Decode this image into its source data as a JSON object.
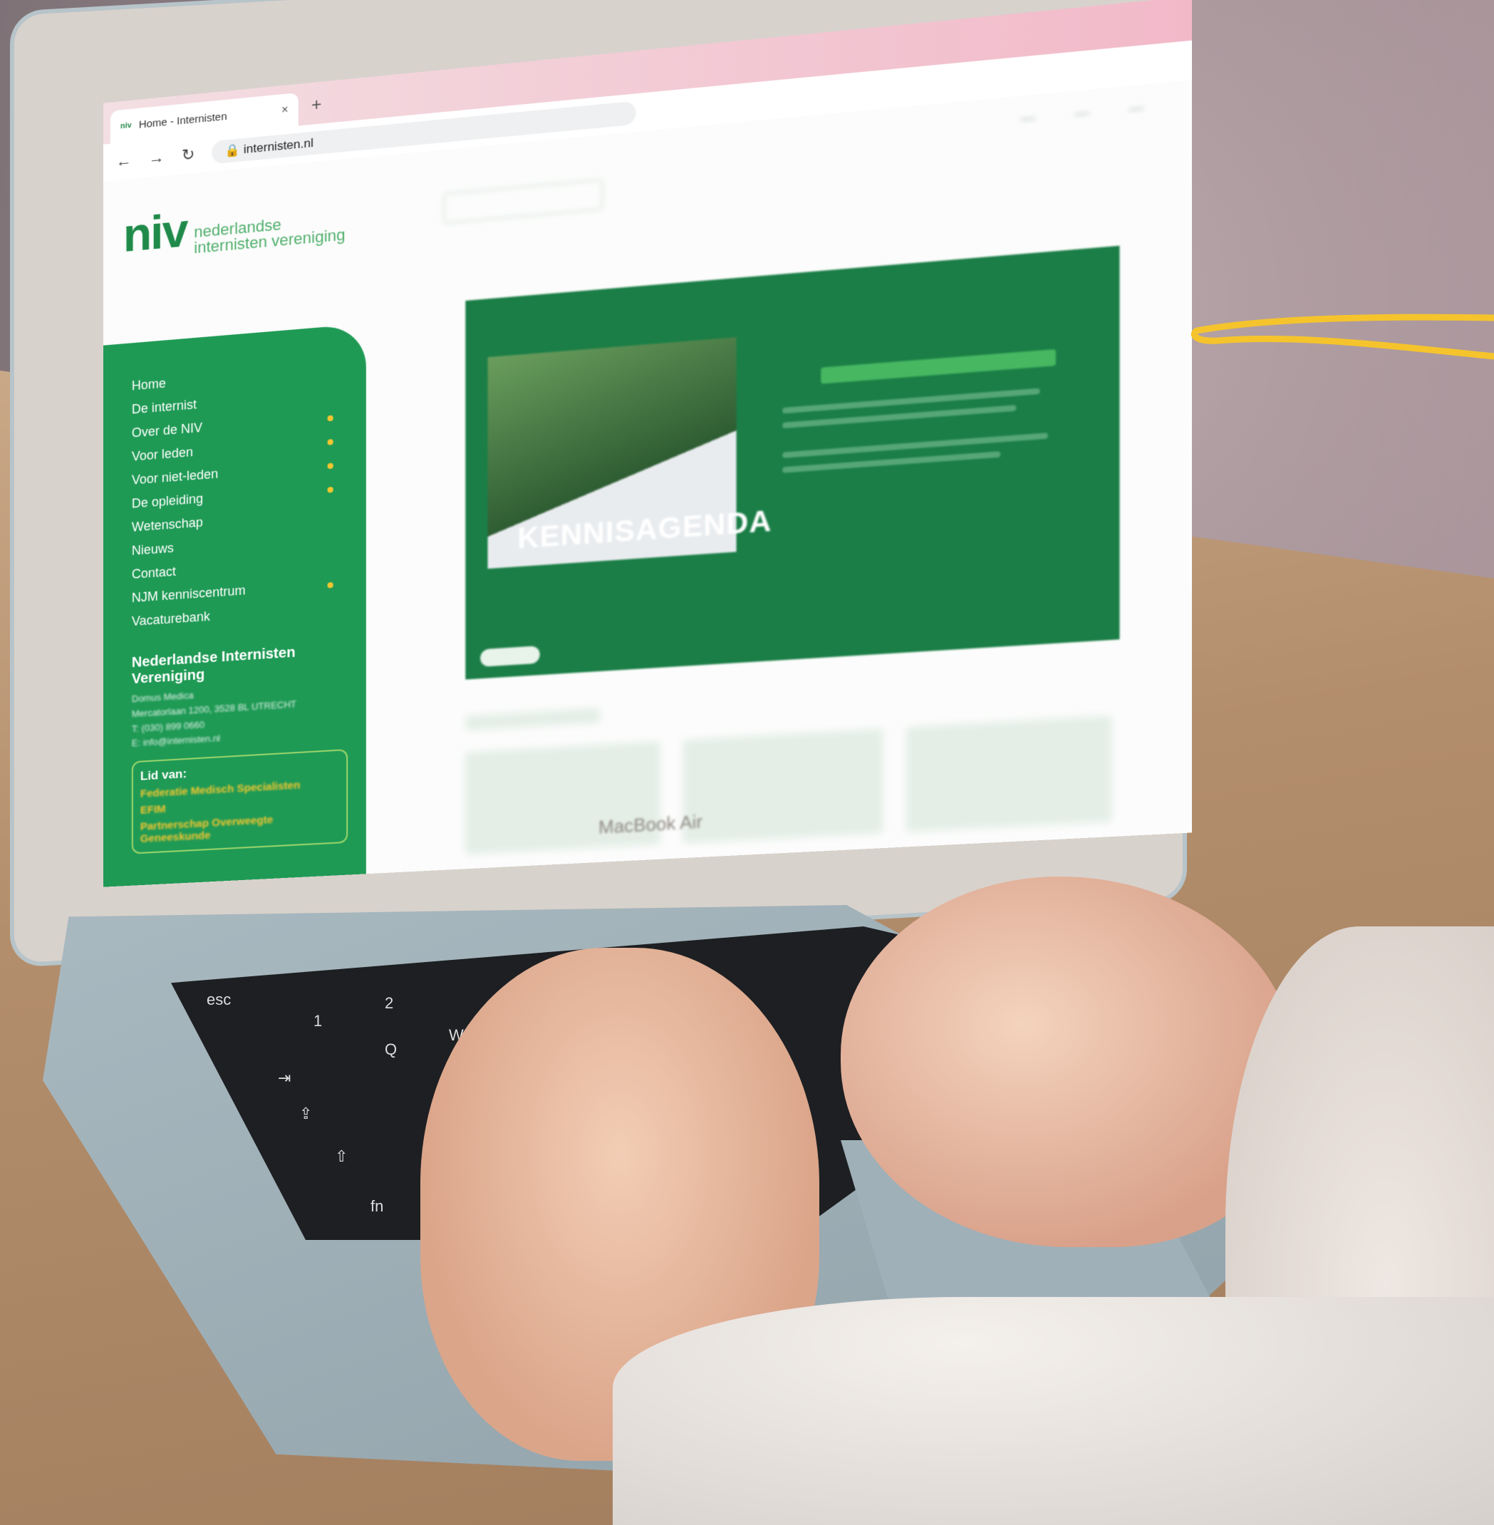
{
  "browser": {
    "tab_title": "Home - Internisten",
    "tab_favicon_text": "niv",
    "close_symbol": "×",
    "new_tab_symbol": "+",
    "url": "internisten.nl"
  },
  "site": {
    "logo_mark": "niv",
    "logo_line1": "nederlandse",
    "logo_line2": "internisten vereniging",
    "nav": [
      {
        "label": "Home",
        "has_submenu": false
      },
      {
        "label": "De internist",
        "has_submenu": false
      },
      {
        "label": "Over de NIV",
        "has_submenu": true
      },
      {
        "label": "Voor leden",
        "has_submenu": true
      },
      {
        "label": "Voor niet-leden",
        "has_submenu": true
      },
      {
        "label": "De opleiding",
        "has_submenu": true
      },
      {
        "label": "Wetenschap",
        "has_submenu": false
      },
      {
        "label": "Nieuws",
        "has_submenu": false
      },
      {
        "label": "Contact",
        "has_submenu": false
      },
      {
        "label": "NJM kenniscentrum",
        "has_submenu": true
      },
      {
        "label": "Vacaturebank",
        "has_submenu": false
      }
    ],
    "org_name": "Nederlandse Internisten Vereniging",
    "address_line1": "Domus Medica",
    "address_line2": "Mercatorlaan 1200, 3528 BL UTRECHT",
    "phone": "T: (030) 899 0660",
    "email": "E: info@internisten.nl",
    "member_of_title": "Lid van:",
    "member_of": [
      "Federatie Medisch Specialisten",
      "EFIM",
      "Partnerschap Overweegte Geneeskunde"
    ],
    "hero_word": "KENNISAGENDA"
  },
  "laptop_label": "MacBook Air",
  "keyboard_labels": [
    "esc",
    "!",
    "1",
    "@",
    "2",
    "Q",
    "W",
    "⇥",
    "⇪",
    "⇧",
    "fn"
  ],
  "colors": {
    "brand_green": "#1f9a55",
    "accent_yellow": "#f3c630",
    "swoosh_yellow": "#f5c42c"
  }
}
